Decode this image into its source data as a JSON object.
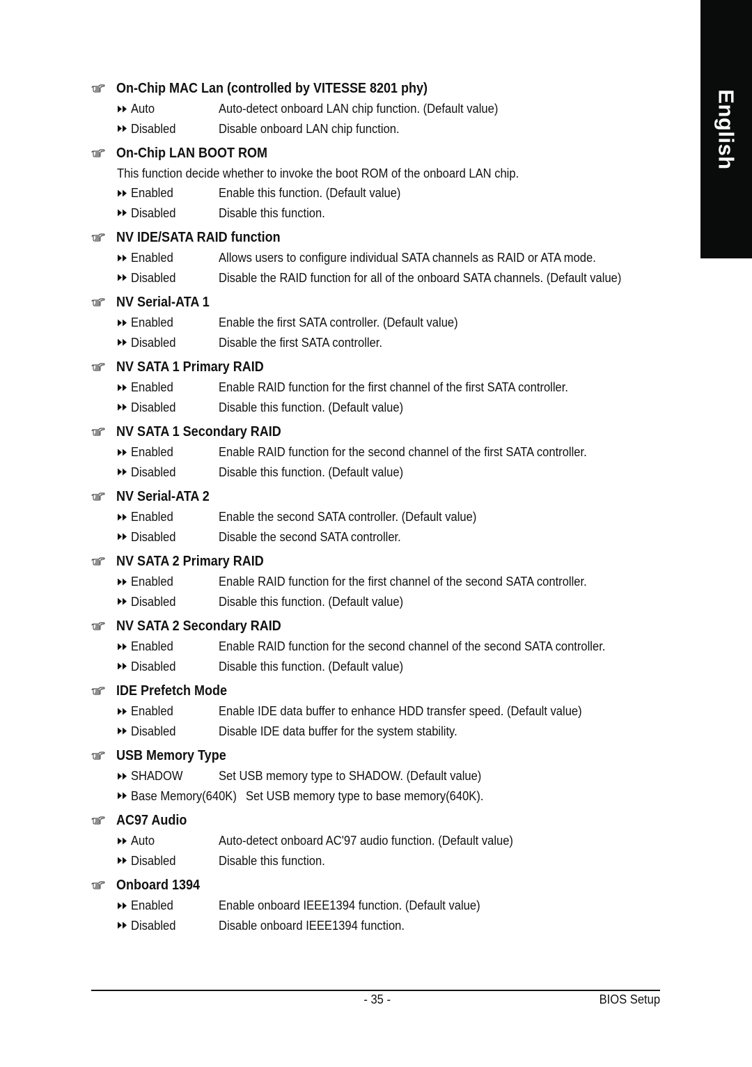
{
  "language_tab": "English",
  "sections": [
    {
      "title": "On-Chip MAC Lan (controlled by VITESSE 8201 phy)",
      "options": [
        {
          "name": "Auto",
          "text": "Auto-detect onboard LAN chip function. (Default value)"
        },
        {
          "name": "Disabled",
          "text": "Disable onboard LAN chip function."
        }
      ]
    },
    {
      "title": "On-Chip LAN BOOT ROM",
      "description": "This function decide whether to invoke the boot ROM of the onboard LAN chip.",
      "options": [
        {
          "name": "Enabled",
          "text": "Enable this function. (Default value)"
        },
        {
          "name": "Disabled",
          "text": "Disable this function."
        }
      ]
    },
    {
      "title": "NV IDE/SATA RAID function",
      "options": [
        {
          "name": "Enabled",
          "text": "Allows users to configure individual SATA channels as RAID or ATA mode."
        },
        {
          "name": "Disabled",
          "text": "Disable the RAID function for all of the onboard SATA channels. (Default value)"
        }
      ]
    },
    {
      "title": "NV Serial-ATA 1",
      "options": [
        {
          "name": "Enabled",
          "text": "Enable the first SATA controller. (Default value)"
        },
        {
          "name": "Disabled",
          "text": "Disable the first SATA controller."
        }
      ]
    },
    {
      "title": "NV SATA 1 Primary RAID",
      "options": [
        {
          "name": "Enabled",
          "text": "Enable RAID function for the first channel of the first SATA controller."
        },
        {
          "name": "Disabled",
          "text": "Disable this function. (Default value)"
        }
      ]
    },
    {
      "title": "NV SATA 1 Secondary RAID",
      "options": [
        {
          "name": "Enabled",
          "text": "Enable RAID function for the second channel of the first SATA controller."
        },
        {
          "name": "Disabled",
          "text": "Disable this function. (Default value)"
        }
      ]
    },
    {
      "title": "NV Serial-ATA 2",
      "options": [
        {
          "name": "Enabled",
          "text": "Enable the second SATA controller. (Default value)"
        },
        {
          "name": "Disabled",
          "text": "Disable the second SATA controller."
        }
      ]
    },
    {
      "title": "NV SATA 2 Primary RAID",
      "options": [
        {
          "name": "Enabled",
          "text": "Enable RAID function for the first channel of the second SATA controller."
        },
        {
          "name": "Disabled",
          "text": "Disable this function. (Default value)"
        }
      ]
    },
    {
      "title": "NV SATA 2 Secondary RAID",
      "options": [
        {
          "name": "Enabled",
          "text": "Enable RAID function for the second channel of the second SATA controller."
        },
        {
          "name": "Disabled",
          "text": "Disable this function. (Default value)"
        }
      ]
    },
    {
      "title": "IDE Prefetch Mode",
      "options": [
        {
          "name": "Enabled",
          "text": "Enable IDE data buffer to enhance HDD transfer speed. (Default value)"
        },
        {
          "name": "Disabled",
          "text": "Disable IDE data buffer for the system stability."
        }
      ]
    },
    {
      "title": "USB Memory Type",
      "options": [
        {
          "name": "SHADOW",
          "text": "Set USB memory type to SHADOW. (Default value)"
        },
        {
          "name": "Base Memory(640K)",
          "text": "Set USB memory type to base memory(640K)."
        }
      ]
    },
    {
      "title": "AC97 Audio",
      "options": [
        {
          "name": "Auto",
          "text": "Auto-detect onboard AC'97 audio function. (Default value)"
        },
        {
          "name": "Disabled",
          "text": "Disable this function."
        }
      ]
    },
    {
      "title": "Onboard 1394",
      "options": [
        {
          "name": "Enabled",
          "text": "Enable onboard IEEE1394 function. (Default value)"
        },
        {
          "name": "Disabled",
          "text": "Disable onboard IEEE1394 function."
        }
      ]
    }
  ],
  "icons": {
    "section_bullet": "pointing-hand-icon",
    "option_bullet": "double-arrow-icon"
  },
  "footer": {
    "page_number": "- 35 -",
    "title": "BIOS Setup"
  }
}
